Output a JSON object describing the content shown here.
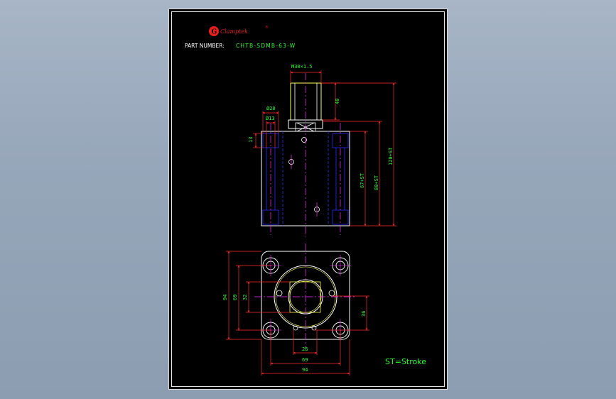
{
  "logo": {
    "brand": "Clamptek",
    "mark": "G",
    "registered": "®"
  },
  "header": {
    "part_number_label": "PART NUMBER:",
    "part_number": "CHTB-SDMB-63-W"
  },
  "dimensions": {
    "thread": "M30×1.5",
    "rod_length": "40",
    "dia_outer": "Ø20",
    "dia_inner": "Ø13",
    "counterbore_depth": "13",
    "body_height": "67+ST",
    "body_port_height": "80+ST",
    "total_height": "120+ST",
    "port_spacing_v": "32",
    "hole_spacing_v": "69",
    "width_v": "94",
    "offset_36": "36",
    "port_spacing_h": "26",
    "hole_spacing_h": "69",
    "width_h": "94"
  },
  "note": "ST=Stroke",
  "colors": {
    "background": "#000000",
    "outline": "#ffffff",
    "hidden": "#2b2bff",
    "center": "#ff2bff",
    "dimension": "#ff2b2b",
    "dim_text": "#2cff2c",
    "yellow": "#ffff55",
    "brand_red": "#e8201e"
  }
}
